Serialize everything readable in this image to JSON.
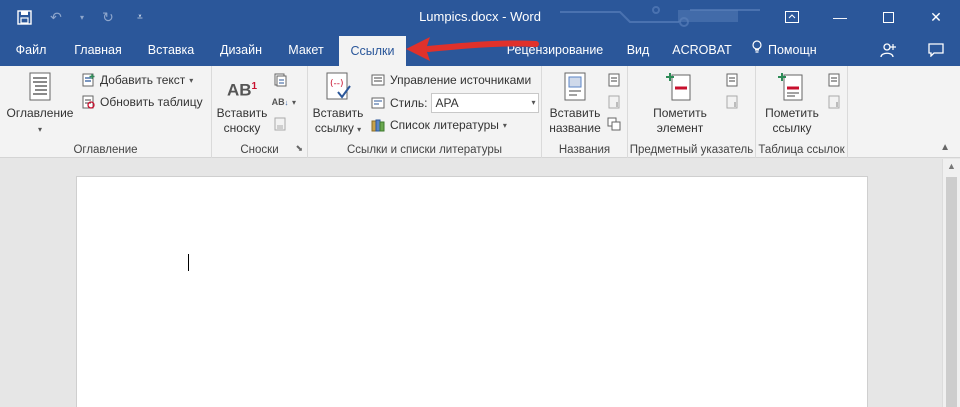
{
  "window": {
    "title": "Lumpics.docx - Word"
  },
  "tabs": [
    {
      "label": "Файл"
    },
    {
      "label": "Главная"
    },
    {
      "label": "Вставка"
    },
    {
      "label": "Дизайн"
    },
    {
      "label": "Макет"
    },
    {
      "label": "Ссылки",
      "active": true
    },
    {
      "label": "Рецензирование"
    },
    {
      "label": "Вид"
    },
    {
      "label": "ACROBAT"
    }
  ],
  "help": {
    "label": "Помощн"
  },
  "ribbon": {
    "toc": {
      "button": "Оглавление",
      "add_text": "Добавить текст",
      "update_table": "Обновить таблицу",
      "group_label": "Оглавление"
    },
    "footnotes": {
      "insert_footnote_line1": "Вставить",
      "insert_footnote_line2": "сноску",
      "icon_text": "AB",
      "icon_sup": "1",
      "group_label": "Сноски"
    },
    "citations": {
      "insert_citation_line1": "Вставить",
      "insert_citation_line2": "ссылку",
      "manage_sources": "Управление источниками",
      "style_label": "Стиль:",
      "style_value": "APA",
      "bibliography": "Список литературы",
      "group_label": "Ссылки и списки литературы"
    },
    "captions": {
      "insert_caption_line1": "Вставить",
      "insert_caption_line2": "название",
      "group_label": "Названия"
    },
    "index": {
      "mark_entry_line1": "Пометить",
      "mark_entry_line2": "элемент",
      "group_label": "Предметный указатель"
    },
    "toa": {
      "mark_citation_line1": "Пометить",
      "mark_citation_line2": "ссылку",
      "group_label": "Таблица ссылок"
    }
  },
  "colors": {
    "titlebar": "#2b579a",
    "ribbon": "#f3f3f3",
    "arrow": "#e0312b"
  }
}
